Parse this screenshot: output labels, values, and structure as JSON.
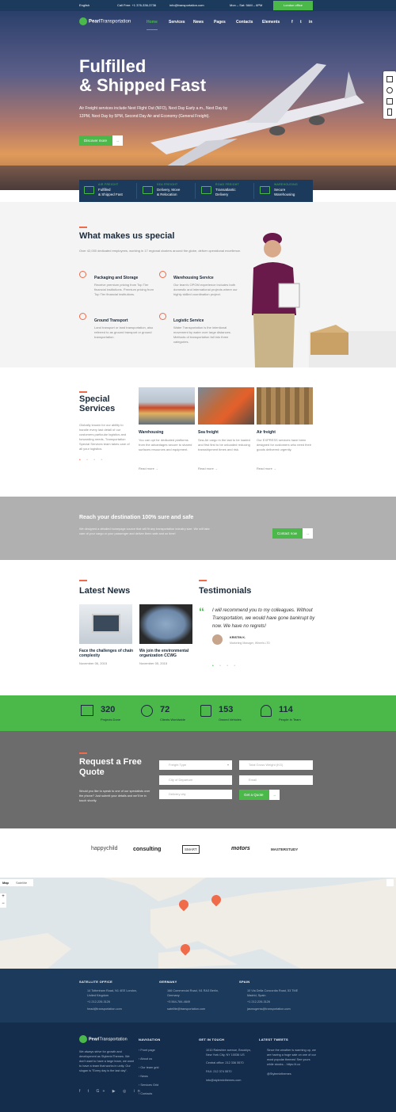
{
  "topbar": {
    "language": "English",
    "phone": "Call Free: +1 376-336-3736",
    "email": "info@transportation.com",
    "hours": "Mon – Sat: 9AM – 6PM",
    "location_button": "London office"
  },
  "nav": {
    "logo_bold": "Pearl",
    "logo_rest": "Transportation",
    "items": [
      "Home",
      "Services",
      "News",
      "Pages",
      "Contacts",
      "Elements"
    ]
  },
  "hero": {
    "title_line1": "Fulfilled",
    "title_line2": "& Shipped Fast",
    "subtitle": "Air Freight services include Next Flight Out (NFO), Next Day Early a.m., Next Day by 12PM, Next Day by 5PM, Second Day Air and Economy (General Freight).",
    "cta": "Discover more"
  },
  "service_strip": [
    {
      "tag": "AIR FREIGHT",
      "desc1": "Fulfilled",
      "desc2": "& Shipped Fast"
    },
    {
      "tag": "SEA FREIGHT",
      "desc1": "Delivery, Move",
      "desc2": "& Relocation"
    },
    {
      "tag": "ROAD FREIGHT",
      "desc1": "Transatlantic",
      "desc2": "Delivery"
    },
    {
      "tag": "WAREHOUSING",
      "desc1": "Secure",
      "desc2": "Warehousing"
    }
  ],
  "special": {
    "title": "What makes us special",
    "intro": "Over 42,000 dedicated employees, working in 17 regional clusters around the globe, deliver operational excellence.",
    "features": [
      {
        "title": "Packaging and Storage",
        "text": "Receive premium pricing from Top Tier financial institutions. Premium pricing from Top Tier financial institutions."
      },
      {
        "title": "Warehousing Service",
        "text": "Our team's OPOM experience includes both domestic and international projects where our highly skilled coordination project."
      },
      {
        "title": "Ground Transport",
        "text": "Land transport or land transportation, also referred to as ground transport or ground transportation."
      },
      {
        "title": "Logistic Service",
        "text": "Water Transportation is the intentional movement by water over large distances. Methods of transportation fall into three categories."
      }
    ]
  },
  "special_services": {
    "title_line1": "Special",
    "title_line2": "Services",
    "text": "Globally known for our ability to handle every last detail of our customers particular logistics and forwarding needs, Transportation Special Services team takes care of all your logistics.",
    "cards": [
      {
        "title": "Warehousing",
        "text": "You can opt for dedicated platforms from the advantages secure to shared surfaces resources and equipment.",
        "more": "Read more"
      },
      {
        "title": "Sea freight",
        "text": "Sea-Air cargo in the last to be loaded and first first to be unloaded reducing transshipment times and risk.",
        "more": "Read more"
      },
      {
        "title": "Air freight",
        "text": "Our EXPRESS services have been designed for customers who need their goods delivered urgently.",
        "more": "Read more"
      }
    ]
  },
  "band": {
    "title": "Reach your destination 100% sure and safe",
    "text": "We designed a detailed homepage source that will fit any transportation industry size. We will take care of your cargo or your passenger and deliver them safe and on time!",
    "button": "Contact now"
  },
  "news": {
    "title": "Latest News",
    "items": [
      {
        "title": "Face the challenges of chain complexity",
        "date": "November 06, 2015"
      },
      {
        "title": "We join the environmental organization CCWG",
        "date": "November 05, 2015"
      }
    ]
  },
  "testimonials": {
    "title": "Testimonials",
    "quote": "I will recommend you to my colleagues. Without Transportation, we would have gone bankrupt by now. We have no regrets!",
    "name": "KRISTIN K.",
    "role": "Marketing Manager, Wheels LTD"
  },
  "stats": [
    {
      "num": "320",
      "label": "Projects Done"
    },
    {
      "num": "72",
      "label": "Clients Worldwide"
    },
    {
      "num": "153",
      "label": "Owned Vehicles"
    },
    {
      "num": "114",
      "label": "People In Team"
    }
  ],
  "quote": {
    "title_line1": "Request a Free",
    "title_line2": "Quote",
    "text": "Would you like to speak to one of our specialists over the phone? Just submit your details and we'll be in touch shortly.",
    "fields": [
      "Freight Type",
      "Total Gross Weight (KG)",
      "City of Departure",
      "Email",
      "Delivery city"
    ],
    "button": "Get a Quote"
  },
  "brands": [
    "happychild",
    "consulting",
    "SMART",
    "motors",
    "MASTERSTUDY"
  ],
  "map": {
    "tab_map": "Map",
    "tab_sat": "Satellite"
  },
  "offices": [
    {
      "title": "SATELLITE OFFICE",
      "address": "14 Tottenham Road, N1 4EE London, United Kingdom",
      "phone": "+1 212-226-3126",
      "email": "head@transportation.com"
    },
    {
      "title": "GERMANY",
      "address": "166 Commercial Road, N1 RA3 Berlin, Germany",
      "phone": "+3 564-784-4849",
      "email": "satellite@transportation.com"
    },
    {
      "title": "SPAIN",
      "address": "10 Via Della Concordia Road, 53 TME Madrid, Spain",
      "phone": "+1 212-226-3126",
      "email": "jasmugerss@transportation.com"
    }
  ],
  "footer": {
    "about": "We always strive for growth and development as StylemixThemes. We don't want to have a large team, we want to have a team that works in unity. Our slogan is \"Every day is the last day\".",
    "nav_title": "NAVIGATION",
    "nav_items": [
      "Front page",
      "About us",
      "Our team grid",
      "News",
      "Services Grid",
      "Contacts"
    ],
    "contact_title": "GET IN TOUCH",
    "contact_lines": [
      "1010 Raleshire avenue, Brooklyn, New York City, NY 10036 US",
      "Central office: 212 336 5570",
      "FAX: 212 374 5570",
      "info@stylemixthemes.com"
    ],
    "tweets_title": "LATEST TWEETS",
    "tweet": "Since the weather is warming up, we are having a huge sale on one of our most popular themes! See yours while stocks... https://t.co",
    "tweet_meta": "@Stylemixthemes"
  },
  "colors": {
    "accent": "#4ab94a",
    "navy": "#1b3a5c",
    "orange": "#f06b4a"
  }
}
